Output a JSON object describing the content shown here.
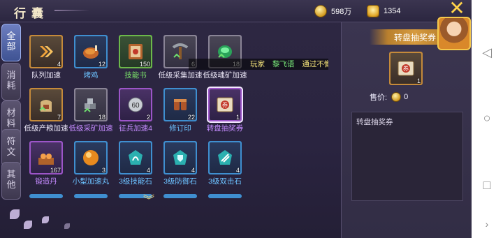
{
  "header": {
    "title": "行囊",
    "currency1": "598万",
    "currency2": "1354",
    "close_icon": "x-icon"
  },
  "tabs": [
    {
      "label": "全部",
      "active": true
    },
    {
      "label": "消耗",
      "active": false
    },
    {
      "label": "材料",
      "active": false
    },
    {
      "label": "符文",
      "active": false
    },
    {
      "label": "其他",
      "active": false
    }
  ],
  "items": [
    {
      "name": "队列加速",
      "count": "4",
      "quality": "orange",
      "label_color": "#e9e4f4",
      "icon": "double-chevron-icon"
    },
    {
      "name": "烤鸡",
      "count": "12",
      "quality": "blue",
      "label_color": "#6cc2ff",
      "icon": "roast-chicken-icon"
    },
    {
      "name": "技能书",
      "count": "150",
      "quality": "green",
      "label_color": "#7be36a",
      "icon": "skill-book-icon"
    },
    {
      "name": "低级采集加速",
      "count": "6",
      "quality": "gray",
      "label_color": "#e9e4f4",
      "icon": "pickaxe-icon"
    },
    {
      "name": "低级魂矿加速",
      "count": "18",
      "quality": "gray",
      "label_color": "#e9e4f4",
      "icon": "green-gem-icon"
    },
    {
      "name": "低级产粮加速",
      "count": "7",
      "quality": "orange",
      "label_color": "#e9e4f4",
      "icon": "grain-sack-icon"
    },
    {
      "name": "低级采矿加速",
      "count": "18",
      "quality": "gray",
      "label_color": "#c58bff",
      "icon": "ore-stack-icon"
    },
    {
      "name": "征兵加速4",
      "count": "2",
      "quality": "purple",
      "label_color": "#c58bff",
      "icon": "recruit-60-icon"
    },
    {
      "name": "修订印",
      "count": "22",
      "quality": "blue",
      "label_color": "#6cc2ff",
      "icon": "seal-icon"
    },
    {
      "name": "转盘抽奖券",
      "count": "1",
      "quality": "purple",
      "label_color": "#c58bff",
      "icon": "lottery-ticket-icon",
      "selected": true
    },
    {
      "name": "锻造丹",
      "count": "167",
      "quality": "purple",
      "label_color": "#c58bff",
      "icon": "forge-pill-icon"
    },
    {
      "name": "小型加速丸",
      "count": "3",
      "quality": "blue",
      "label_color": "#6cc2ff",
      "icon": "orange-orb-icon"
    },
    {
      "name": "3级技能石",
      "count": "4",
      "quality": "blue",
      "label_color": "#6cc2ff",
      "icon": "skill-stone-icon"
    },
    {
      "name": "3级防御石",
      "count": "4",
      "quality": "blue",
      "label_color": "#6cc2ff",
      "icon": "defense-stone-icon"
    },
    {
      "name": "3级双击石",
      "count": "4",
      "quality": "blue",
      "label_color": "#6cc2ff",
      "icon": "double-hit-stone-icon"
    }
  ],
  "marquee": {
    "part1": "玩家",
    "part2": "黎飞语",
    "part3": "通过不懈努"
  },
  "detail": {
    "title": "转盘抽奖券",
    "count": "1",
    "price_label": "售价:",
    "price_value": "0",
    "description": "转盘抽奖券"
  },
  "colors": {
    "accent_gold": "#d69a3e",
    "tab_active": "#3f5393",
    "selected_outline": "#f3e9ff"
  }
}
